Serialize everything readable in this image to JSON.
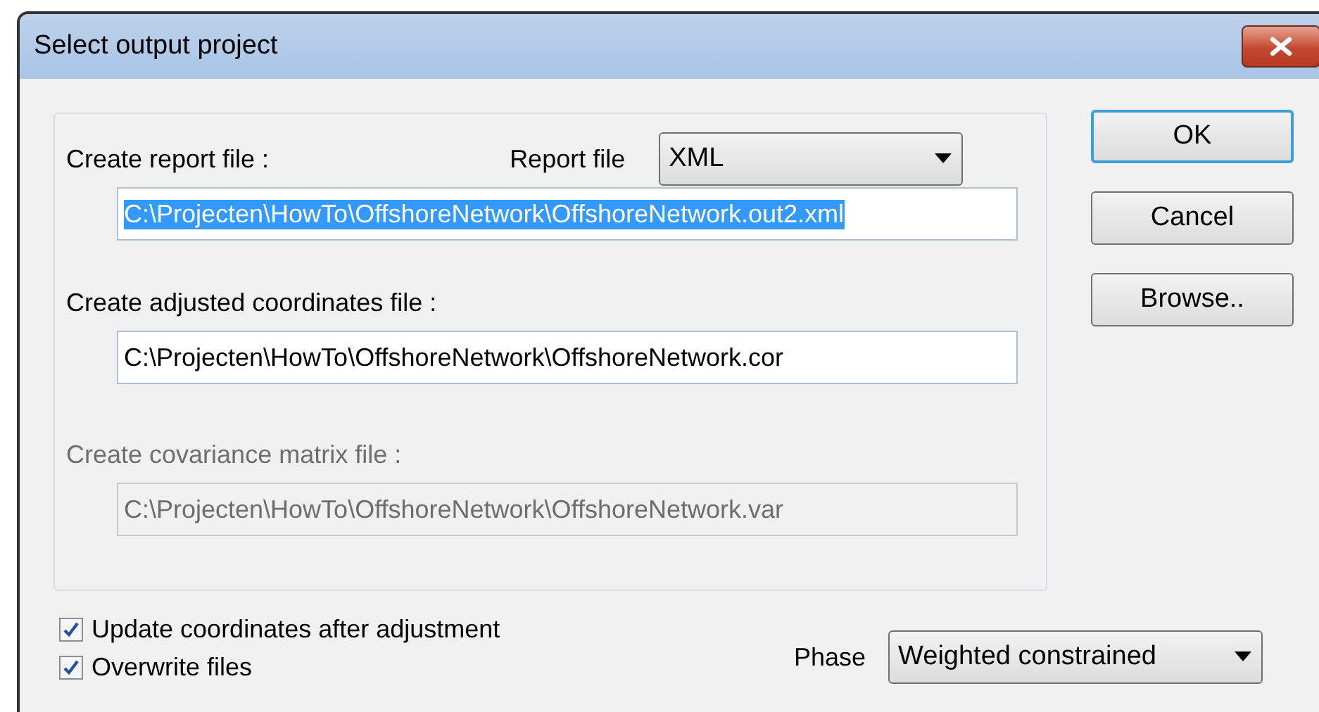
{
  "window": {
    "title": "Select output project"
  },
  "sections": [
    {
      "label": "Create report file :",
      "disabled": false,
      "selected_text": true,
      "value": "C:\\Projecten\\HowTo\\OffshoreNetwork\\OffshoreNetwork.out2.xml",
      "select": {
        "label": "Report file",
        "value": "XML"
      }
    },
    {
      "label": "Create adjusted coordinates file :",
      "disabled": false,
      "selected_text": false,
      "value": "C:\\Projecten\\HowTo\\OffshoreNetwork\\OffshoreNetwork.cor"
    },
    {
      "label": "Create covariance matrix file :",
      "disabled": true,
      "selected_text": false,
      "value": "C:\\Projecten\\HowTo\\OffshoreNetwork\\OffshoreNetwork.var"
    }
  ],
  "buttons": [
    {
      "label": "OK",
      "default": true
    },
    {
      "label": "Cancel",
      "default": false
    },
    {
      "label": "Browse..",
      "default": false
    }
  ],
  "checkboxes": [
    {
      "label": "Update coordinates after adjustment",
      "checked": true
    },
    {
      "label": "Overwrite files",
      "checked": true
    }
  ],
  "phase": {
    "label": "Phase",
    "value": "Weighted constrained"
  }
}
